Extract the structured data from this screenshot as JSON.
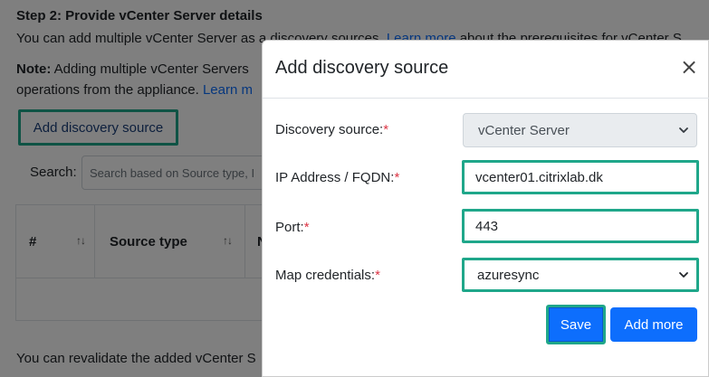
{
  "background": {
    "step_title": "Step 2: Provide vCenter Server details",
    "step_desc_before": "You can add multiple vCenter Server as a discovery sources. ",
    "step_desc_link": "Learn more",
    "step_desc_after": " about the prerequisites for vCenter S",
    "note_bold": "Note:",
    "note_text": " Adding multiple vCenter Servers",
    "note_line2": "operations from the appliance. ",
    "note_link": "Learn m",
    "add_source_label": "Add discovery source",
    "search_label": "Search:",
    "search_placeholder": "Search based on Source type, I",
    "table_headers": [
      "#",
      "Source type",
      "N"
    ],
    "revalidate_text": "You can revalidate the added vCenter S"
  },
  "modal": {
    "title": "Add discovery source",
    "close_glyph": "×",
    "fields": {
      "source": {
        "label": "Discovery source:",
        "value": "vCenter Server"
      },
      "ip": {
        "label": "IP Address / FQDN:",
        "value": "vcenter01.citrixlab.dk"
      },
      "port": {
        "label": "Port:",
        "value": "443"
      },
      "credentials": {
        "label": "Map credentials:",
        "value": "azuresync"
      }
    },
    "required_mark": "*",
    "save_label": "Save",
    "add_more_label": "Add more"
  },
  "colors": {
    "highlight": "#1fa78a",
    "primary": "#0d6efd",
    "required": "#dc3545"
  }
}
